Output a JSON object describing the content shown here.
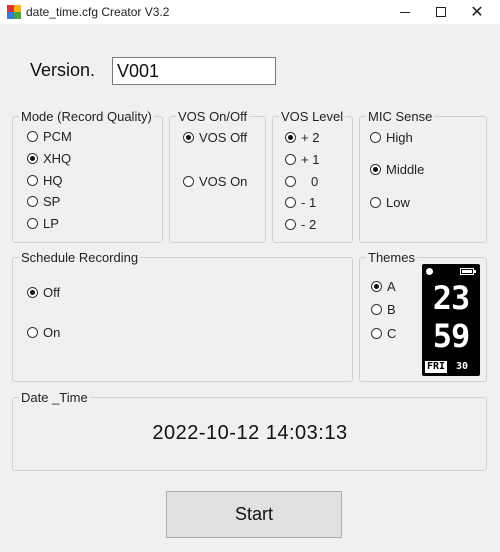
{
  "window": {
    "title": "date_time.cfg Creator V3.2",
    "minimize_icon": "minimize-icon",
    "maximize_icon": "maximize-icon",
    "close_glyph": "✕"
  },
  "version": {
    "label": "Version.",
    "value": "V001"
  },
  "mode": {
    "title": "Mode (Record Quality)",
    "options": [
      {
        "label": "PCM",
        "checked": false
      },
      {
        "label": "XHQ",
        "checked": true
      },
      {
        "label": "HQ",
        "checked": false
      },
      {
        "label": "SP",
        "checked": false
      },
      {
        "label": "LP",
        "checked": false
      }
    ]
  },
  "vos": {
    "title": "VOS On/Off",
    "options": [
      {
        "label": "VOS Off",
        "checked": true
      },
      {
        "label": "VOS On",
        "checked": false
      }
    ]
  },
  "vos_level": {
    "title": "VOS Level",
    "options": [
      {
        "label": "+ 2",
        "checked": true
      },
      {
        "label": "+ 1",
        "checked": false
      },
      {
        "label": "0",
        "checked": false
      },
      {
        "label": "- 1",
        "checked": false
      },
      {
        "label": "- 2",
        "checked": false
      }
    ]
  },
  "mic_sense": {
    "title": "MIC Sense",
    "options": [
      {
        "label": "High",
        "checked": false
      },
      {
        "label": "Middle",
        "checked": true
      },
      {
        "label": "Low",
        "checked": false
      }
    ]
  },
  "schedule": {
    "title": "Schedule Recording",
    "options": [
      {
        "label": "Off",
        "checked": true
      },
      {
        "label": "On",
        "checked": false
      }
    ]
  },
  "themes": {
    "title": "Themes",
    "options": [
      {
        "label": "A",
        "checked": true
      },
      {
        "label": "B",
        "checked": false
      },
      {
        "label": "C",
        "checked": false
      }
    ],
    "preview": {
      "hour": "23",
      "minute": "59",
      "day": "FRI",
      "date": "30"
    }
  },
  "date_time": {
    "title": "Date _Time",
    "value": "2022-10-12 14:03:13"
  },
  "start_button": {
    "label": "Start"
  }
}
